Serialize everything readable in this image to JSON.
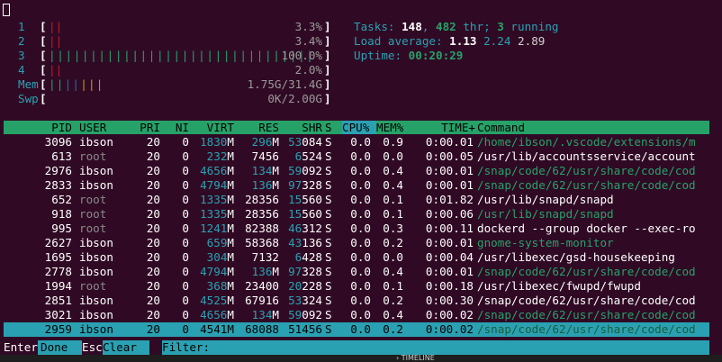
{
  "meters": {
    "cpus": [
      {
        "num": "1",
        "bar": "||",
        "bar_colors": [
          "r",
          "r"
        ],
        "value": "3.3%"
      },
      {
        "num": "2",
        "bar": "||",
        "bar_colors": [
          "r",
          "r"
        ],
        "value": "3.4%"
      },
      {
        "num": "3",
        "bar_green": "||||||||||||||||||||||||||||||||",
        "value": "100.0%"
      },
      {
        "num": "4",
        "bar": "||",
        "bar_colors": [
          "r",
          "r"
        ],
        "value": "2.0%"
      }
    ],
    "mem": {
      "label": "Mem",
      "value": "1.75G/31.4G"
    },
    "swp": {
      "label": "Swp",
      "value": "0K/2.00G"
    }
  },
  "stats": {
    "tasks_label": "Tasks: ",
    "tasks": "148",
    "thr_sep": ", ",
    "thr": "482",
    "thr_label": " thr; ",
    "running": "3",
    "running_label": " running",
    "load_label": "Load average: ",
    "load1": "1.13",
    "load5": "2.24",
    "load15": "2.89",
    "uptime_label": "Uptime: ",
    "uptime": "00:20:29"
  },
  "columns": {
    "pid": "PID",
    "user": "USER",
    "pri": "PRI",
    "ni": "NI",
    "virt": "VIRT",
    "res": "RES",
    "shr": "SHR",
    "s": "S",
    "cpu": "CPU%",
    "mem": "MEM%",
    "time": "TIME+",
    "cmd": "Command"
  },
  "processes": [
    {
      "pid": "3096",
      "user": "ibson",
      "pri": "20",
      "ni": "0",
      "virt_n": "1830",
      "virt_u": "M",
      "res_n": "296",
      "res_u": "M",
      "shr_h": "53",
      "shr_t": "084",
      "s": "S",
      "cpu": "0.0",
      "mem": "0.9",
      "time": "0:00.01",
      "cmd": "/home/ibson/.vscode/extensions/m",
      "cmd_green": true
    },
    {
      "pid": "613",
      "user": "root",
      "pri": "20",
      "ni": "0",
      "virt_n": "232",
      "virt_u": "M",
      "res_n": "7456",
      "res_u": "",
      "shr_h": "6",
      "shr_t": "524",
      "s": "S",
      "cpu": "0.0",
      "mem": "0.0",
      "time": "0:00.05",
      "cmd": "/usr/lib/accountsservice/account",
      "cmd_green": false
    },
    {
      "pid": "2976",
      "user": "ibson",
      "pri": "20",
      "ni": "0",
      "virt_n": "4656",
      "virt_u": "M",
      "res_n": "134",
      "res_u": "M",
      "shr_h": "59",
      "shr_t": "092",
      "s": "S",
      "cpu": "0.0",
      "mem": "0.4",
      "time": "0:00.01",
      "cmd": "/snap/code/62/usr/share/code/cod",
      "cmd_green": true
    },
    {
      "pid": "2833",
      "user": "ibson",
      "pri": "20",
      "ni": "0",
      "virt_n": "4794",
      "virt_u": "M",
      "res_n": "136",
      "res_u": "M",
      "shr_h": "97",
      "shr_t": "328",
      "s": "S",
      "cpu": "0.0",
      "mem": "0.4",
      "time": "0:00.01",
      "cmd": "/snap/code/62/usr/share/code/cod",
      "cmd_green": true
    },
    {
      "pid": "652",
      "user": "root",
      "pri": "20",
      "ni": "0",
      "virt_n": "1335",
      "virt_u": "M",
      "res_n": "28356",
      "res_u": "",
      "shr_h": "15",
      "shr_t": "560",
      "s": "S",
      "cpu": "0.0",
      "mem": "0.1",
      "time": "0:01.82",
      "cmd": "/usr/lib/snapd/snapd",
      "cmd_green": false
    },
    {
      "pid": "918",
      "user": "root",
      "pri": "20",
      "ni": "0",
      "virt_n": "1335",
      "virt_u": "M",
      "res_n": "28356",
      "res_u": "",
      "shr_h": "15",
      "shr_t": "560",
      "s": "S",
      "cpu": "0.0",
      "mem": "0.1",
      "time": "0:00.06",
      "cmd": "/usr/lib/snapd/snapd",
      "cmd_green": true
    },
    {
      "pid": "995",
      "user": "root",
      "pri": "20",
      "ni": "0",
      "virt_n": "1241",
      "virt_u": "M",
      "res_n": "82388",
      "res_u": "",
      "shr_h": "46",
      "shr_t": "312",
      "s": "S",
      "cpu": "0.0",
      "mem": "0.3",
      "time": "0:00.11",
      "cmd": "dockerd --group docker --exec-ro",
      "cmd_green": false
    },
    {
      "pid": "2627",
      "user": "ibson",
      "pri": "20",
      "ni": "0",
      "virt_n": "659",
      "virt_u": "M",
      "res_n": "58368",
      "res_u": "",
      "shr_h": "43",
      "shr_t": "136",
      "s": "S",
      "cpu": "0.0",
      "mem": "0.2",
      "time": "0:00.01",
      "cmd": "gnome-system-monitor",
      "cmd_green": true
    },
    {
      "pid": "1695",
      "user": "ibson",
      "pri": "20",
      "ni": "0",
      "virt_n": "304",
      "virt_u": "M",
      "res_n": "7132",
      "res_u": "",
      "shr_h": "6",
      "shr_t": "428",
      "s": "S",
      "cpu": "0.0",
      "mem": "0.0",
      "time": "0:00.04",
      "cmd": "/usr/libexec/gsd-housekeeping",
      "cmd_green": false
    },
    {
      "pid": "2778",
      "user": "ibson",
      "pri": "20",
      "ni": "0",
      "virt_n": "4794",
      "virt_u": "M",
      "res_n": "136",
      "res_u": "M",
      "shr_h": "97",
      "shr_t": "328",
      "s": "S",
      "cpu": "0.0",
      "mem": "0.4",
      "time": "0:00.01",
      "cmd": "/snap/code/62/usr/share/code/cod",
      "cmd_green": true
    },
    {
      "pid": "1994",
      "user": "root",
      "pri": "20",
      "ni": "0",
      "virt_n": "368",
      "virt_u": "M",
      "res_n": "23400",
      "res_u": "",
      "shr_h": "20",
      "shr_t": "228",
      "s": "S",
      "cpu": "0.0",
      "mem": "0.1",
      "time": "0:00.18",
      "cmd": "/usr/libexec/fwupd/fwupd",
      "cmd_green": false
    },
    {
      "pid": "2851",
      "user": "ibson",
      "pri": "20",
      "ni": "0",
      "virt_n": "4525",
      "virt_u": "M",
      "res_n": "67916",
      "res_u": "",
      "shr_h": "53",
      "shr_t": "324",
      "s": "S",
      "cpu": "0.0",
      "mem": "0.2",
      "time": "0:00.30",
      "cmd": "/snap/code/62/usr/share/code/cod",
      "cmd_green": false
    },
    {
      "pid": "3021",
      "user": "ibson",
      "pri": "20",
      "ni": "0",
      "virt_n": "4656",
      "virt_u": "M",
      "res_n": "134",
      "res_u": "M",
      "shr_h": "59",
      "shr_t": "092",
      "s": "S",
      "cpu": "0.0",
      "mem": "0.4",
      "time": "0:00.02",
      "cmd": "/snap/code/62/usr/share/code/cod",
      "cmd_green": true
    },
    {
      "pid": "2959",
      "user": "ibson",
      "pri": "20",
      "ni": "0",
      "virt_n": "4541",
      "virt_u": "M",
      "res_n": "68088",
      "res_u": "",
      "shr_h": "51",
      "shr_t": "456",
      "s": "S",
      "cpu": "0.0",
      "mem": "0.2",
      "time": "0:00.02",
      "cmd": "/snap/code/62/usr/share/code/cod",
      "cmd_green": true,
      "selected": true
    }
  ],
  "footer": {
    "enter_key": "Enter",
    "enter_label": "Done",
    "esc_key": "Esc",
    "esc_label": "Clear",
    "filter_label": " Filter: "
  },
  "taskbar": {
    "timeline": "TIMELINE"
  }
}
